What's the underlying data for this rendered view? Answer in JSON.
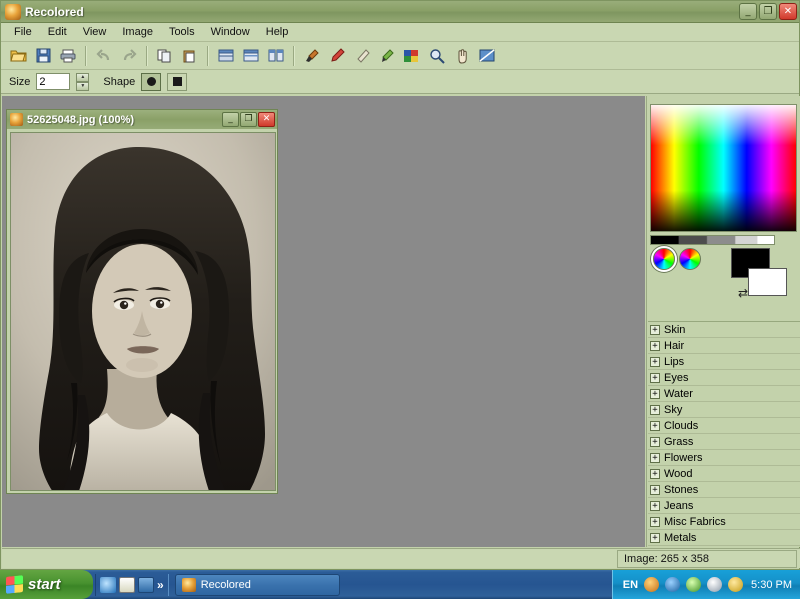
{
  "window": {
    "title": "Recolored",
    "icon": "app-icon",
    "buttons": {
      "minimize": "_",
      "maximize": "❐",
      "close": "✕"
    }
  },
  "menu": [
    {
      "label": "File"
    },
    {
      "label": "Edit"
    },
    {
      "label": "View"
    },
    {
      "label": "Image"
    },
    {
      "label": "Tools"
    },
    {
      "label": "Window"
    },
    {
      "label": "Help"
    }
  ],
  "toolbar": [
    {
      "name": "open-button",
      "icon": "folder-open-icon"
    },
    {
      "name": "save-button",
      "icon": "floppy-disk-icon"
    },
    {
      "name": "print-button",
      "icon": "printer-icon"
    },
    {
      "name": "undo-button",
      "icon": "undo-arrow-icon"
    },
    {
      "name": "redo-button",
      "icon": "redo-arrow-icon"
    },
    {
      "name": "copy-button",
      "icon": "copy-icon"
    },
    {
      "name": "paste-button",
      "icon": "paste-icon"
    },
    {
      "name": "tile-button",
      "icon": "tile-windows-icon"
    },
    {
      "name": "cascade-button",
      "icon": "cascade-windows-icon"
    },
    {
      "name": "split-view-button",
      "icon": "split-view-icon"
    },
    {
      "name": "brush-tool",
      "icon": "paintbrush-icon"
    },
    {
      "name": "pen-tool",
      "icon": "pen-icon"
    },
    {
      "name": "eraser-tool",
      "icon": "eraser-icon"
    },
    {
      "name": "marker-tool",
      "icon": "marker-icon"
    },
    {
      "name": "color-picker-tool",
      "icon": "color-swatch-icon"
    },
    {
      "name": "zoom-tool",
      "icon": "magnifier-icon"
    },
    {
      "name": "pan-tool",
      "icon": "hand-icon"
    },
    {
      "name": "mask-tool",
      "icon": "mask-icon"
    }
  ],
  "options": {
    "size_label": "Size",
    "size_value": "2",
    "shape_label": "Shape",
    "shape_round": "round-brush-shape",
    "shape_square": "square-brush-shape",
    "selected_shape": "round"
  },
  "document": {
    "title": "52625048.jpg (100%)",
    "buttons": {
      "minimize": "_",
      "maximize": "❐",
      "close": "✕"
    },
    "image_alt": "black-and-white portrait photograph of a woman with long dark hair"
  },
  "color_panel": {
    "gradient": "hue-saturation-gradient",
    "gray_ramp": "grayscale-ramp",
    "wheel_primary": "color-wheel-primary",
    "wheel_secondary": "color-wheel-secondary",
    "foreground_color": "#000000",
    "background_color": "#ffffff",
    "swap_icon": "⇄"
  },
  "categories": [
    {
      "label": "Skin",
      "expander": "+"
    },
    {
      "label": "Hair",
      "expander": "+"
    },
    {
      "label": "Lips",
      "expander": "+"
    },
    {
      "label": "Eyes",
      "expander": "+"
    },
    {
      "label": "Water",
      "expander": "+"
    },
    {
      "label": "Sky",
      "expander": "+"
    },
    {
      "label": "Clouds",
      "expander": "+"
    },
    {
      "label": "Grass",
      "expander": "+"
    },
    {
      "label": "Flowers",
      "expander": "+"
    },
    {
      "label": "Wood",
      "expander": "+"
    },
    {
      "label": "Stones",
      "expander": "+"
    },
    {
      "label": "Jeans",
      "expander": "+"
    },
    {
      "label": "Misc Fabrics",
      "expander": "+"
    },
    {
      "label": "Metals",
      "expander": "+"
    }
  ],
  "status": {
    "text": "Image: 265 x 358"
  },
  "taskbar": {
    "start_label": "start",
    "quick_launch": [
      {
        "name": "internet-explorer-icon"
      },
      {
        "name": "notepad-icon"
      },
      {
        "name": "show-desktop-icon"
      },
      {
        "name": "more-chevron-icon",
        "label": "»"
      }
    ],
    "tasks": [
      {
        "label": "Recolored",
        "icon": "app-icon"
      }
    ],
    "tray": {
      "language": "EN",
      "icons": [
        "media-icon",
        "shield-icon",
        "network-icon",
        "volume-icon",
        "update-icon"
      ],
      "clock": "5:30 PM"
    }
  }
}
